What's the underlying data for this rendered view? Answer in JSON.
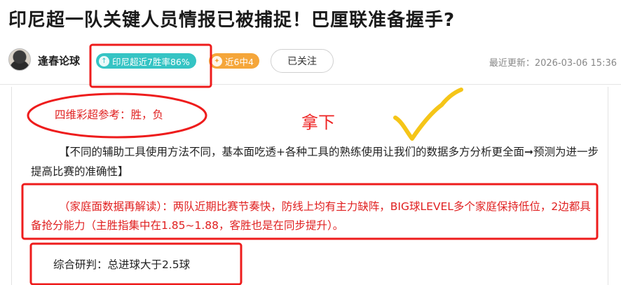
{
  "article": {
    "title": "印尼超一队关键人员情报已被捕捉！巴厘联准备握手?"
  },
  "author": {
    "name": "逢春论球",
    "badge_streak": "印尼超近7胜率86%",
    "badge_recent": "近6中4",
    "follow_label": "已关注",
    "updated": "最近更新：2026-03-06 15:36"
  },
  "content": {
    "reference": "四维彩超参考：胜，负",
    "handwritten_note": "拿下",
    "intro": "【不同的辅助工具使用方法不同，基本面吃透+各种工具的熟练使用让我们的数据多方分析更全面➞预测为进一步提高比赛的准确性】",
    "home_analysis": "（家庭面数据再解读）：两队近期比赛节奏快，防线上均有主力缺阵，BIG球LEVEL多个家庭保持低位，2边都具备抢分能力（主胜指集中在1.85~1.88，客胜也是在同步提升）。",
    "verdict": "综合研判：总进球大于2.5球"
  },
  "colors": {
    "accent_red": "#e02020",
    "badge_green": "#35c4c4",
    "badge_orange": "#f5a63a",
    "checkmark_yellow": "#f5c518"
  }
}
